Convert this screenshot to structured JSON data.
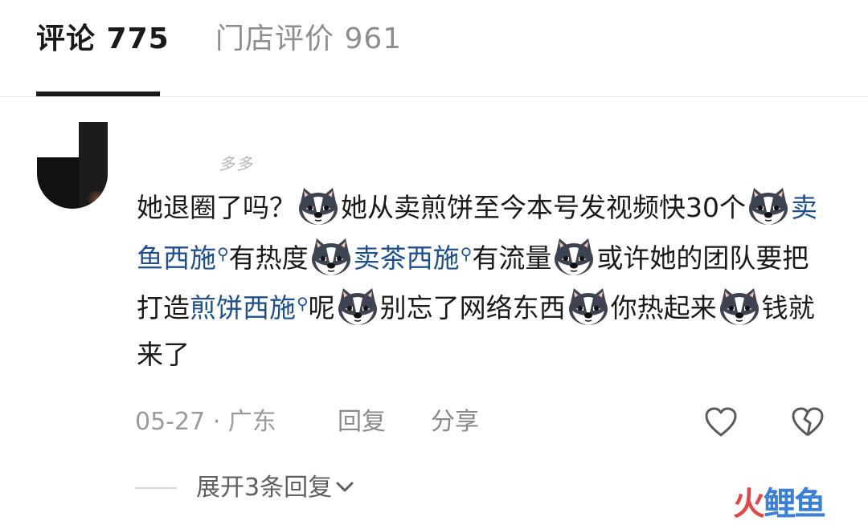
{
  "tabs": [
    {
      "label": "评论 775",
      "active": true
    },
    {
      "label": "门店评价 961",
      "active": false
    }
  ],
  "comment": {
    "username": "多多",
    "segments": [
      {
        "t": "她退圈了吗？"
      },
      {
        "emoji": "husky-emoji"
      },
      {
        "t": "她从卖煎饼至今本号发视频快30个"
      },
      {
        "emoji": "husky-emoji"
      },
      {
        "link": "卖鱼西施"
      },
      {
        "t": "有热度"
      },
      {
        "emoji": "husky-emoji"
      },
      {
        "link": "卖茶西施"
      },
      {
        "t": "有流量"
      },
      {
        "emoji": "husky-emoji"
      },
      {
        "t": "或许她的团队要把打造"
      },
      {
        "link": "煎饼西施"
      },
      {
        "t": "呢"
      },
      {
        "emoji": "husky-emoji"
      },
      {
        "t": "别忘了网络东西"
      },
      {
        "emoji": "husky-emoji"
      },
      {
        "t": "你热起来"
      },
      {
        "emoji": "husky-emoji"
      },
      {
        "t": "钱就来了"
      }
    ],
    "date_location": "05-27 · 广东",
    "reply_label": "回复",
    "share_label": "分享",
    "like_icon": "heart-outline-icon",
    "dislike_icon": "broken-heart-icon",
    "expand_label": "展开3条回复"
  },
  "watermark": {
    "fire": "火",
    "rest": "鲤鱼"
  },
  "colors": {
    "link": "#1e4f8f",
    "accent": "#1a1a1a",
    "muted": "#9a9a9a"
  }
}
